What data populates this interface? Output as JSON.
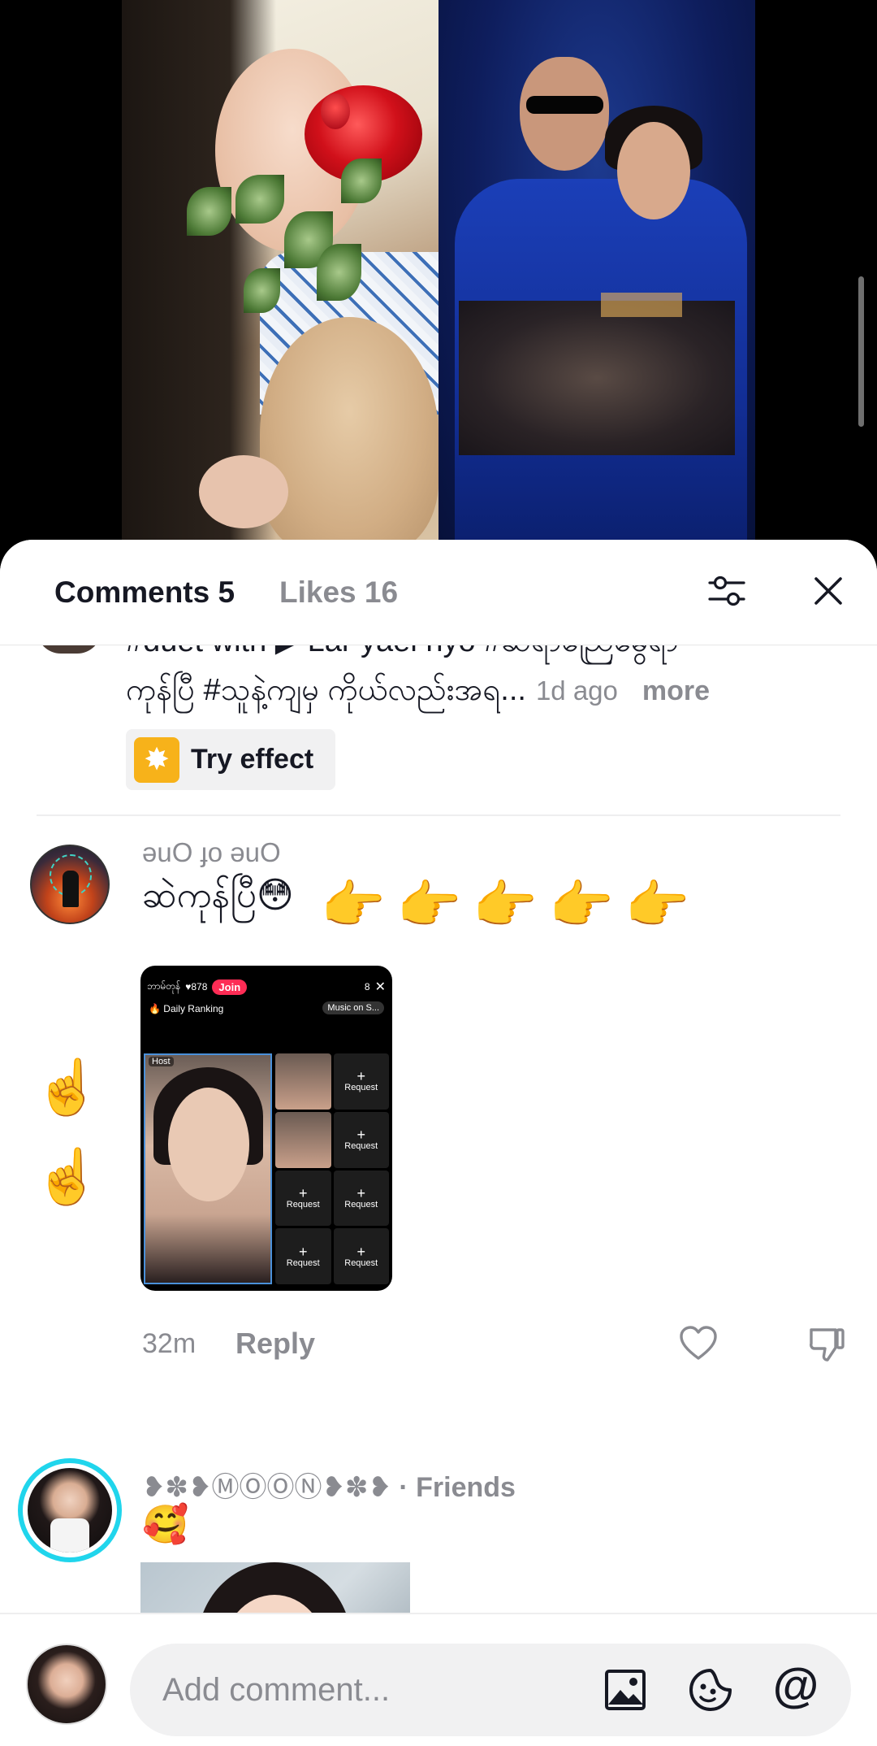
{
  "header": {
    "comments_tab": "Comments 5",
    "likes_tab": "Likes 16"
  },
  "caption": {
    "top_fragment": "#duet with ▶ Lar yaei nyo  #ဆရာညြေမွေရာ",
    "line": "ကုန်ပြီ #သူနဲ့ကျမှ ကိုယ်လည်းအရ",
    "ellipsis": "...",
    "time": "1d ago",
    "more": "more",
    "effect_label": "Try effect"
  },
  "comments": [
    {
      "username": "ǝuO ɟo ǝuO",
      "text": "ဆဲကုန်ပြီ😳",
      "emojis": "👉👉👉👉👉",
      "side_emoji_1": "☝️",
      "side_emoji_2": "☝️",
      "attachment": {
        "host_name": "ဘာမ်တုန်",
        "likes": "♥878",
        "join": "Join",
        "guest_count": "8",
        "daily_ranking": "🔥 Daily Ranking",
        "music": "Music on S...",
        "host_label": "Host",
        "request": "Request",
        "plus": "+"
      },
      "time": "32m",
      "reply": "Reply"
    },
    {
      "username": "❥✽❥ⓂⓄⓄⓃ❥✽❥",
      "friends": " · Friends",
      "text": "🥰"
    }
  ],
  "input": {
    "placeholder": "Add comment...",
    "mention": "@"
  },
  "icons": [
    "filter-icon",
    "close-icon",
    "heart-icon",
    "dislike-icon",
    "image-icon",
    "sticker-icon",
    "mention-icon"
  ],
  "colors": {
    "primary_text": "#161823",
    "secondary_text": "#8a8b91",
    "friends_ring": "#20d5ec",
    "join_button": "#fe2c55"
  }
}
